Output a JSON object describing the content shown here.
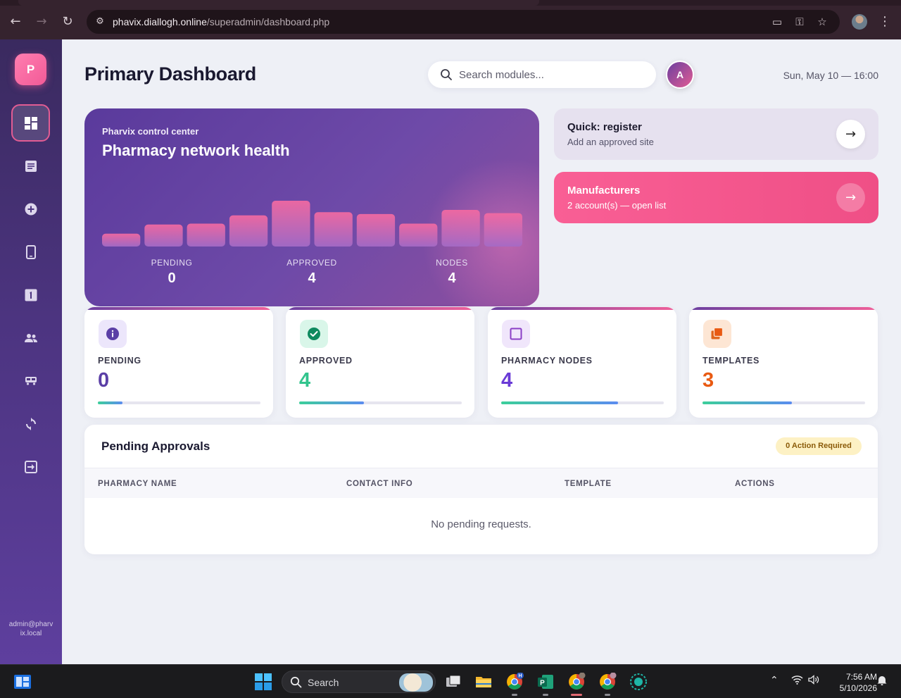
{
  "browser": {
    "url_host": "phavix.diallogh.online",
    "url_path": "/superadmin/dashboard.php"
  },
  "sidebar": {
    "logo_letter": "P",
    "items": [
      {
        "icon": "dashboard-icon",
        "active": true
      },
      {
        "icon": "document-list-icon",
        "active": false
      },
      {
        "icon": "add-circle-icon",
        "active": false
      },
      {
        "icon": "mobile-device-icon",
        "active": false
      },
      {
        "icon": "number-one-box-icon",
        "active": false
      },
      {
        "icon": "people-icon",
        "active": false
      },
      {
        "icon": "transit-icon",
        "active": false
      },
      {
        "icon": "sync-icon",
        "active": false
      },
      {
        "icon": "logout-icon",
        "active": false
      }
    ],
    "user_email": "admin@pharvix.local"
  },
  "header": {
    "title": "Primary Dashboard",
    "search_placeholder": "Search modules...",
    "avatar_letter": "A",
    "datetime": "Sun, May 10 — 16:00"
  },
  "hero": {
    "eyebrow": "Pharvix control center",
    "title": "Pharmacy network health",
    "bar_levels": [
      0.28,
      0.48,
      0.5,
      0.68,
      1.0,
      0.75,
      0.71,
      0.5,
      0.8,
      0.73
    ],
    "stats": [
      {
        "label": "PENDING",
        "value": "0"
      },
      {
        "label": "APPROVED",
        "value": "4"
      },
      {
        "label": "NODES",
        "value": "4"
      }
    ]
  },
  "quick": [
    {
      "title": "Quick: register",
      "subtitle": "Add an approved site",
      "button": "→"
    },
    {
      "title": "Manufacturers",
      "subtitle": "2 account(s) — open list",
      "button": "→"
    }
  ],
  "stats": [
    {
      "label": "PENDING",
      "value": "0",
      "progress": 0.15,
      "color": "#5b3fa6",
      "icon": "info-icon",
      "icon_bg": "#ece6fb"
    },
    {
      "label": "APPROVED",
      "value": "4",
      "progress": 0.4,
      "color": "#32c48d",
      "icon": "check-circle-icon",
      "icon_bg": "#d9f6e9"
    },
    {
      "label": "PHARMACY NODES",
      "value": "4",
      "progress": 0.72,
      "color": "#6a3bd6",
      "icon": "square-outline-icon",
      "icon_bg": "#f0e6fb"
    },
    {
      "label": "TEMPLATES",
      "value": "3",
      "progress": 0.55,
      "color": "#e95a12",
      "icon": "layers-icon",
      "icon_bg": "#fde6d4"
    }
  ],
  "pending": {
    "title": "Pending Approvals",
    "badge": "0 Action Required",
    "columns": [
      "PHARMACY NAME",
      "CONTACT INFO",
      "TEMPLATE",
      "ACTIONS"
    ],
    "empty_text": "No pending requests."
  },
  "taskbar": {
    "search_label": "Search",
    "time": "7:56 AM",
    "date": "5/10/2026"
  }
}
